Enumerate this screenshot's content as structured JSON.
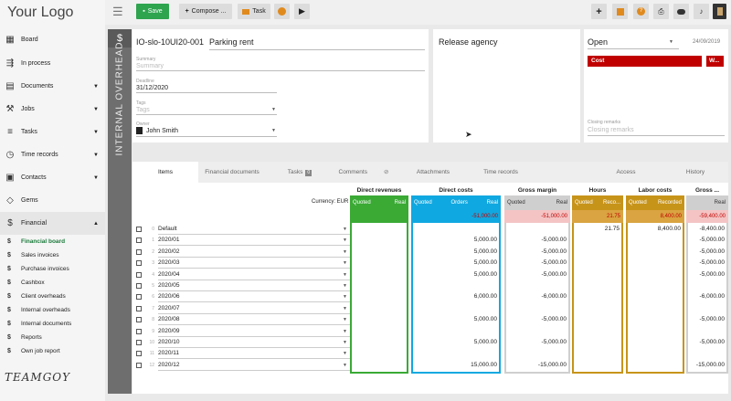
{
  "logo": "Your Logo",
  "footer_logo": "TEAMGOY",
  "sidebar": {
    "items": [
      {
        "label": "Board",
        "icon": "grid-icon",
        "caret": ""
      },
      {
        "label": "In process",
        "icon": "flow-icon",
        "caret": ""
      },
      {
        "label": "Documents",
        "icon": "document-icon",
        "caret": "▼"
      },
      {
        "label": "Jobs",
        "icon": "wrench-icon",
        "caret": "▼"
      },
      {
        "label": "Tasks",
        "icon": "tasks-icon",
        "caret": "▼"
      },
      {
        "label": "Time records",
        "icon": "clock-icon",
        "caret": "▼"
      },
      {
        "label": "Contacts",
        "icon": "contacts-icon",
        "caret": "▼"
      },
      {
        "label": "Gems",
        "icon": "gem-icon",
        "caret": ""
      },
      {
        "label": "Financial",
        "icon": "dollar-icon",
        "caret": "▲"
      }
    ],
    "subitems": [
      {
        "label": "Financial board",
        "icon": "$"
      },
      {
        "label": "Sales invoices",
        "icon": "$"
      },
      {
        "label": "Purchase invoices",
        "icon": "$"
      },
      {
        "label": "Cashbox",
        "icon": "$"
      },
      {
        "label": "Client overheads",
        "icon": "$"
      },
      {
        "label": "Internal overheads",
        "icon": "$"
      },
      {
        "label": "Internal documents",
        "icon": "$"
      },
      {
        "label": "Reports",
        "icon": "$"
      },
      {
        "label": "Own job report",
        "icon": "$"
      }
    ]
  },
  "toolbar": {
    "save_label": "Save",
    "compose_label": "Compose ...",
    "task_label": "Task",
    "plus": "+",
    "colors": {
      "save": "#2ea44f",
      "orange": "#e08a1e"
    }
  },
  "side_label": "INTERNAL OVERHEAD",
  "doc": {
    "code": "IO-slo-10UI20-001",
    "title": "Parking rent",
    "summary_label": "Summary",
    "summary_placeholder": "Summary",
    "deadline_label": "Deadline",
    "deadline": "31/12/2020",
    "tags_label": "Tags",
    "tags_placeholder": "Tags",
    "owner_label": "Owner",
    "owner": "John Smith"
  },
  "release": {
    "title": "Release agency"
  },
  "status": {
    "value": "Open",
    "date": "24/09/2019",
    "badge1": "Cost",
    "badge2": "W...",
    "closing_label": "Closing remarks",
    "closing_placeholder": "Closing remarks"
  },
  "tabs": [
    "Items",
    "Financial documents",
    "Tasks",
    "Comments",
    "Attachments",
    "Time records",
    "Access",
    "History"
  ],
  "tasks_badge": "0",
  "grid": {
    "currency_label": "Currency: EUR",
    "groups": [
      {
        "title": "Direct revenues",
        "sub1": "Quoted",
        "sub2": "Real",
        "color": "#3aaa35",
        "border": "#3aaa35",
        "total": ""
      },
      {
        "title": "Direct costs",
        "sub1": "Quoted",
        "sub1b": "Orders",
        "sub2": "Real",
        "color": "#10a8e0",
        "border": "#10a8e0",
        "total": "-51,000.00",
        "total_bg": "#f4c4c4",
        "total_color": "#c00000"
      },
      {
        "title": "Gross margin",
        "sub1": "Quoted",
        "sub2": "Real",
        "color": "#cfcfcf",
        "border": "#cfcfcf",
        "total": "-51,000.00",
        "total_bg": "#f4c4c4",
        "total_color": "#c00000"
      },
      {
        "title": "Hours",
        "sub1": "Quoted",
        "sub2": "Reco...",
        "color": "#c7941a",
        "border": "#c7941a",
        "total": "21.75",
        "total_bg": "#f4c4c4",
        "total_color": "#c00000"
      },
      {
        "title": "Labor costs",
        "sub1": "Quoted",
        "sub2": "Recorded",
        "color": "#c7941a",
        "border": "#c7941a",
        "total": "8,400.00",
        "total_bg": "#f4c4c4",
        "total_color": "#c00000"
      },
      {
        "title": "Gross ...",
        "sub1": "",
        "sub2": "Real",
        "color": "#cfcfcf",
        "border": "#cfcfcf",
        "total": "-59,400.00",
        "total_bg": "#f4c4c4",
        "total_color": "#c00000"
      }
    ],
    "rows": [
      {
        "n": "0",
        "label": "Default",
        "dc": "",
        "gm": "",
        "hours": "21.75",
        "labor": "8,400.00",
        "gross": "-8,400.00"
      },
      {
        "n": "1",
        "label": "2020/01",
        "dc": "5,000.00",
        "gm": "-5,000.00",
        "hours": "",
        "labor": "",
        "gross": "-5,000.00"
      },
      {
        "n": "2",
        "label": "2020/02",
        "dc": "5,000.00",
        "gm": "-5,000.00",
        "hours": "",
        "labor": "",
        "gross": "-5,000.00"
      },
      {
        "n": "3",
        "label": "2020/03",
        "dc": "5,000.00",
        "gm": "-5,000.00",
        "hours": "",
        "labor": "",
        "gross": "-5,000.00"
      },
      {
        "n": "4",
        "label": "2020/04",
        "dc": "5,000.00",
        "gm": "-5,000.00",
        "hours": "",
        "labor": "",
        "gross": "-5,000.00"
      },
      {
        "n": "5",
        "label": "2020/05",
        "dc": "",
        "gm": "",
        "hours": "",
        "labor": "",
        "gross": ""
      },
      {
        "n": "6",
        "label": "2020/06",
        "dc": "6,000.00",
        "gm": "-6,000.00",
        "hours": "",
        "labor": "",
        "gross": "-6,000.00"
      },
      {
        "n": "7",
        "label": "2020/07",
        "dc": "",
        "gm": "",
        "hours": "",
        "labor": "",
        "gross": ""
      },
      {
        "n": "8",
        "label": "2020/08",
        "dc": "5,000.00",
        "gm": "-5,000.00",
        "hours": "",
        "labor": "",
        "gross": "-5,000.00"
      },
      {
        "n": "9",
        "label": "2020/09",
        "dc": "",
        "gm": "",
        "hours": "",
        "labor": "",
        "gross": ""
      },
      {
        "n": "10",
        "label": "2020/10",
        "dc": "5,000.00",
        "gm": "-5,000.00",
        "hours": "",
        "labor": "",
        "gross": "-5,000.00"
      },
      {
        "n": "11",
        "label": "2020/11",
        "dc": "",
        "gm": "",
        "hours": "",
        "labor": "",
        "gross": ""
      },
      {
        "n": "12",
        "label": "2020/12",
        "dc": "15,000.00",
        "gm": "-15,000.00",
        "hours": "",
        "labor": "",
        "gross": "-15,000.00"
      }
    ]
  }
}
